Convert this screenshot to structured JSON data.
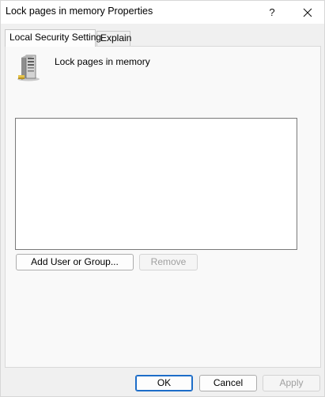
{
  "window": {
    "title": "Lock pages in memory Properties",
    "help_glyph": "?",
    "close_icon": "close-icon"
  },
  "tabs": [
    {
      "label": "Local Security Setting",
      "active": true
    },
    {
      "label": "Explain",
      "active": false
    }
  ],
  "policy": {
    "icon": "server-icon",
    "name": "Lock pages in memory"
  },
  "members": {
    "items": []
  },
  "actions": {
    "add_label": "Add User or Group...",
    "remove_label": "Remove",
    "remove_enabled": false
  },
  "footer": {
    "ok_label": "OK",
    "cancel_label": "Cancel",
    "apply_label": "Apply",
    "apply_enabled": false
  },
  "colors": {
    "window_bg": "#f0f0f0",
    "titlebar_bg": "#ffffff",
    "default_button_border": "#1d6dc8",
    "disabled_text": "#a0a0a0"
  }
}
